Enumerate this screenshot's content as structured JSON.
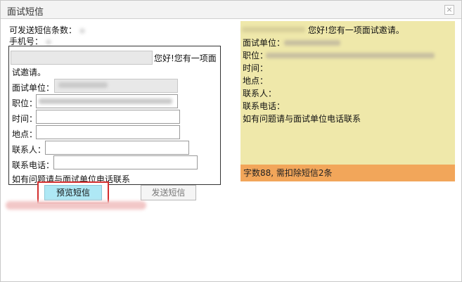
{
  "window": {
    "title": "面试短信",
    "close_glyph": "×"
  },
  "info": {
    "remaining_label": "可发送短信条数：",
    "phone_label": "手机号："
  },
  "editor": {
    "greeting_suffix": "您好!您有一项面",
    "greeting_line2": "试邀请。",
    "company_label": "面试单位：",
    "position_label": "职位：",
    "time_label": "时间：",
    "place_label": "地点：",
    "contact_label": "联系人：",
    "phone_label": "联系电话：",
    "footer": "如有问题请与面试单位电话联系"
  },
  "buttons": {
    "preview": "预览短信",
    "send": "发送短信"
  },
  "preview": {
    "line1_suffix": "您好!您有一项面试邀请。",
    "company_label": "面试单位：",
    "position_label": "职位：",
    "time_label": "时间：",
    "place_label": "地点：",
    "contact_label": "联系人：",
    "phone_label": "联系电话：",
    "footer": "如有问题请与面试单位电话联系",
    "count_text": "字数88, 需扣除短信2条"
  }
}
